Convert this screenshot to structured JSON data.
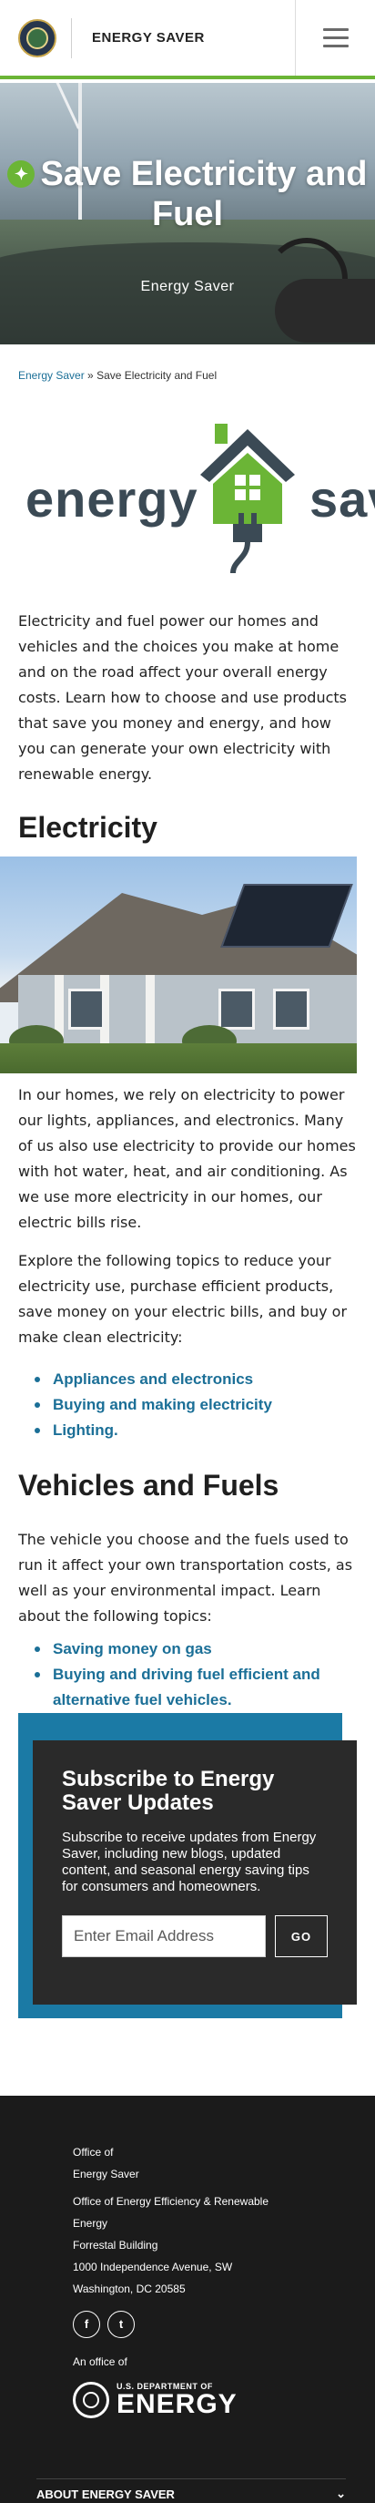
{
  "header": {
    "brand_name": "ENERGY SAVER",
    "menu_icon": "hamburger-menu-icon",
    "accent_color": "#6bb536"
  },
  "hero": {
    "title": "Save Electricity and Fuel",
    "subtitle": "Energy Saver",
    "title_icon": "lightbulb-icon"
  },
  "breadcrumb": {
    "home": "Energy Saver",
    "separator": "»",
    "current": "Save Electricity and Fuel"
  },
  "logo": {
    "word_left": "energy",
    "word_right": "saver"
  },
  "intro": "Electricity and fuel power our homes and vehicles and the choices you make at home and on the road affect your overall energy costs. Learn how to choose and use products that save you money and energy, and how you can generate your own electricity with renewable energy.",
  "electricity": {
    "heading": "Electricity",
    "para1": "In our homes, we rely on electricity to power our lights, appliances, and electronics. Many of us also use electricity to provide our homes with hot water, heat, and air conditioning. As we use more electricity in our homes, our electric bills rise.",
    "para2": "Explore the following topics to reduce your electricity use, purchase efficient products, save money on your electric bills, and buy or make clean electricity:",
    "links": [
      "Appliances and electronics",
      "Buying and making electricity",
      "Lighting."
    ]
  },
  "vehicles": {
    "heading": "Vehicles and Fuels",
    "para": "The vehicle you choose and the fuels used to run it affect your own transportation costs, as well as your environmental impact. Learn about the following topics:",
    "links": [
      "Saving money on gas",
      "Buying and driving fuel efficient and alternative fuel vehicles."
    ]
  },
  "subscribe": {
    "title": "Subscribe to Energy Saver Updates",
    "text": "Subscribe to receive updates from Energy Saver, including new blogs, updated content, and seasonal energy saving tips for consumers and homeowners.",
    "placeholder": "Enter Email Address",
    "button": "GO",
    "accent_color": "#1b7aa5"
  },
  "footer": {
    "office_line1": "Office of",
    "office_line2": "Energy Saver",
    "eere_line1": "Office of Energy Efficiency & Renewable",
    "eere_line2": "Energy",
    "building": "Forrestal Building",
    "street": "1000 Independence Avenue, SW",
    "city": "Washington, DC 20585",
    "social": [
      {
        "icon": "facebook-icon",
        "glyph": "f"
      },
      {
        "icon": "twitter-icon",
        "glyph": "t"
      }
    ],
    "office_of": "An office of",
    "doe_small": "U.S. DEPARTMENT OF",
    "doe_big": "ENERGY",
    "about": "ABOUT ENERGY SAVER"
  }
}
